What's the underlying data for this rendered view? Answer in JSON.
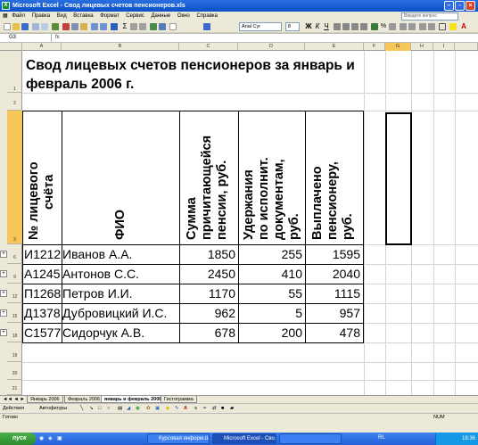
{
  "window": {
    "title": "Microsoft Excel - Свод лицевых счетов пенсионеров.xls"
  },
  "menu": {
    "items": [
      "Файл",
      "Правка",
      "Вид",
      "Вставка",
      "Формат",
      "Сервис",
      "Данные",
      "Окно",
      "Справка"
    ],
    "help_placeholder": "Введите вопрос"
  },
  "toolbar": {
    "font_name": "Arial Cyr",
    "font_size": "8"
  },
  "formula_bar": {
    "cell_ref": "G3",
    "fx": "fx",
    "value": ""
  },
  "columns": [
    "A",
    "B",
    "C",
    "D",
    "E",
    "F",
    "G",
    "H",
    "I"
  ],
  "selected_column": "G",
  "rows": [
    {
      "num": "1"
    },
    {
      "num": "2"
    },
    {
      "num": "3",
      "selected": true
    },
    {
      "num": "6"
    },
    {
      "num": "9"
    },
    {
      "num": "12"
    },
    {
      "num": "15"
    },
    {
      "num": "18"
    },
    {
      "num": "19"
    },
    {
      "num": "20"
    },
    {
      "num": "21"
    }
  ],
  "sheet": {
    "title_line1": "Свод лицевых счетов пенсионеров за январь и",
    "title_line2": "февраль 2006 г.",
    "headers": {
      "account": [
        "№ лицевого",
        "счёта"
      ],
      "name": [
        "ФИО"
      ],
      "accrued": [
        "Сумма",
        "причитающейся",
        "пенсии, руб."
      ],
      "deductions": [
        "Удержания",
        "по исполнит.",
        "документам,",
        "руб."
      ],
      "paid": [
        "Выплачено",
        "пенсионеру,",
        "руб."
      ]
    },
    "records": [
      {
        "account": "И1212",
        "name": "Иванов А.А.",
        "accrued": "1850",
        "deductions": "255",
        "paid": "1595"
      },
      {
        "account": "А1245",
        "name": "Антонов С.С.",
        "accrued": "2450",
        "deductions": "410",
        "paid": "2040"
      },
      {
        "account": "П1268",
        "name": "Петров И.И.",
        "accrued": "1170",
        "deductions": "55",
        "paid": "1115"
      },
      {
        "account": "Д1378",
        "name": "Дубровицкий И.С.",
        "accrued": "962",
        "deductions": "5",
        "paid": "957"
      },
      {
        "account": "С1577",
        "name": "Сидорчук А.В.",
        "accrued": "678",
        "deductions": "200",
        "paid": "478"
      }
    ]
  },
  "sheet_tabs": [
    "Январь 2006",
    "Февраль 2006",
    "январь и февраль 2006",
    "Гистограмма"
  ],
  "active_sheet": "январь и февраль 2006",
  "drawing_bar": {
    "draw_label": "Действия",
    "autoshapes_label": "Автофигуры"
  },
  "status": {
    "left": "Готово",
    "right": "NUM"
  },
  "taskbar": {
    "start_label": "пуск",
    "tasks": [
      "Курсовая информ.d...",
      "Microsoft Excel - Сво...",
      ""
    ],
    "lang": "RL",
    "clock": "18:36"
  }
}
